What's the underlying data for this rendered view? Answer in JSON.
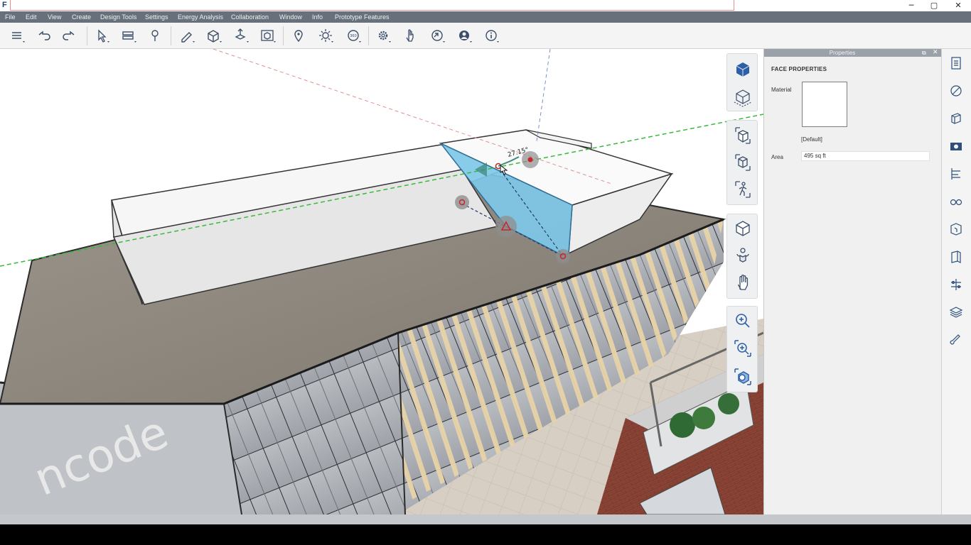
{
  "window": {
    "logo_letter": "F",
    "title_value": "",
    "minimize": "─",
    "maximize": "▢",
    "close": "✕"
  },
  "menu": {
    "items": [
      "File",
      "Edit",
      "View",
      "Create",
      "Design Tools",
      "Settings",
      "Energy Analysis",
      "Collaboration",
      "Window",
      "Info",
      "Prototype Features"
    ]
  },
  "toolbar": {
    "icons": [
      "menu-stack-icon",
      "undo-icon",
      "redo-icon",
      "select-arrow-icon",
      "section-plane-icon",
      "paint-bucket-icon",
      "sketch-pencil-icon",
      "box-primitive-icon",
      "move-push-icon",
      "frame-cube-icon",
      "location-pin-icon",
      "sun-icon",
      "view-360-icon",
      "gear-icon",
      "hand-touch-icon",
      "share-icon",
      "account-icon",
      "info-icon"
    ]
  },
  "viewport": {
    "angle_readout": "27.15°",
    "signage_text": "ncode",
    "face_highlight_color": "#7ec8e8",
    "guide_green": "#3cb83c",
    "guide_red": "#e09090",
    "guide_blue": "#7a8fcf"
  },
  "nav": {
    "group1": [
      "view-cube-icon",
      "ground-view-icon"
    ],
    "group2": [
      "perspective-icon",
      "isometric-icon",
      "walk-icon"
    ],
    "group3": [
      "orbit-icon",
      "look-around-icon",
      "pan-hand-icon"
    ],
    "group4": [
      "zoom-in-icon",
      "zoom-window-icon",
      "zoom-extents-icon"
    ]
  },
  "properties": {
    "header": "Properties",
    "pin": "⧉",
    "close": "✕",
    "section": "FACE PROPERTIES",
    "material_label": "Material",
    "material_name": "[Default]",
    "area_label": "Area",
    "area_value": "495 sq ft"
  },
  "sidebar": {
    "icons": [
      "properties-list-icon",
      "materials-icon",
      "layers-icon",
      "scenes-icon",
      "align-icon",
      "glasses-icon",
      "components-icon",
      "book-icon",
      "transform-icon",
      "stack-icon",
      "paint-icon"
    ]
  }
}
